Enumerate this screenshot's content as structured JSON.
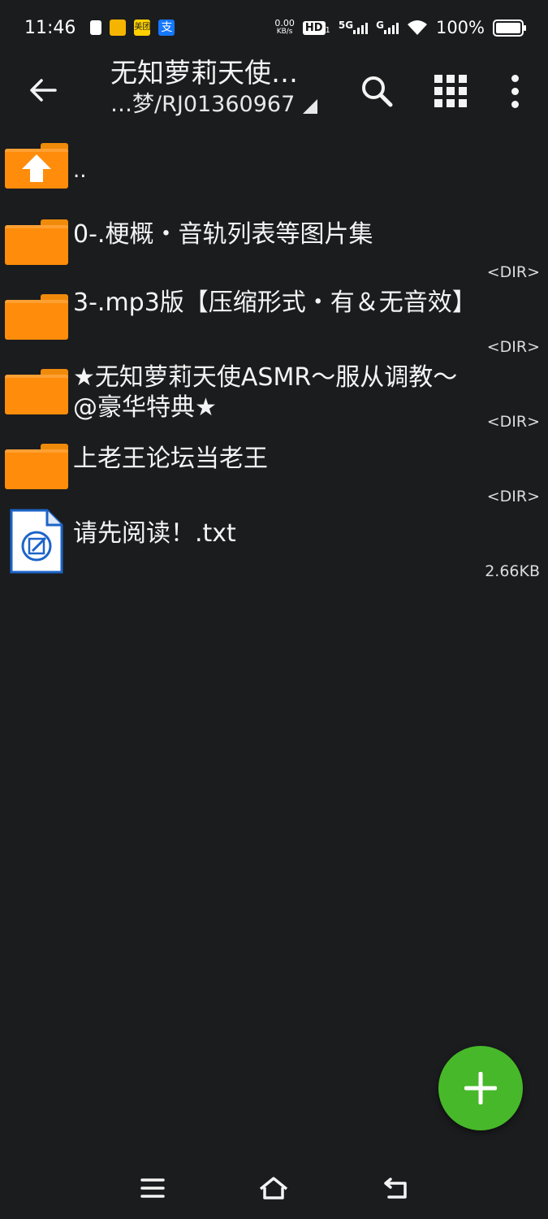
{
  "status_bar": {
    "time": "11:46",
    "net_speed_value": "0.00",
    "net_speed_unit": "KB/s",
    "hd": "HD",
    "hd_sub": "1",
    "network_5g": "5G",
    "network_g": "G",
    "battery": "100%",
    "notif_icons": [
      "check-badge-icon",
      "app-yellow-icon",
      "meituan-icon",
      "alipay-icon"
    ],
    "notif_labels": [
      "美团",
      "支"
    ]
  },
  "toolbar": {
    "title": "无知萝莉天使…",
    "subtitle": "…梦/RJ01360967"
  },
  "files": [
    {
      "type": "up",
      "name": "..",
      "meta": ""
    },
    {
      "type": "dir",
      "name": "0-.梗概・音轨列表等图片集",
      "meta": "<DIR>"
    },
    {
      "type": "dir",
      "name": "3-.mp3版【压缩形式・有＆无音效】",
      "meta": "<DIR>"
    },
    {
      "type": "dir",
      "name": "★无知萝莉天使ASMR～服从调教～@豪华特典★",
      "meta": "<DIR>"
    },
    {
      "type": "dir",
      "name": "上老王论坛当老王",
      "meta": "<DIR>"
    },
    {
      "type": "file",
      "name": "请先阅读！.txt",
      "meta": "2.66KB"
    }
  ],
  "colors": {
    "background": "#1b1c1e",
    "folder": "#ff8c0a",
    "fab": "#47b82a",
    "file_icon": "#1c64c8"
  }
}
